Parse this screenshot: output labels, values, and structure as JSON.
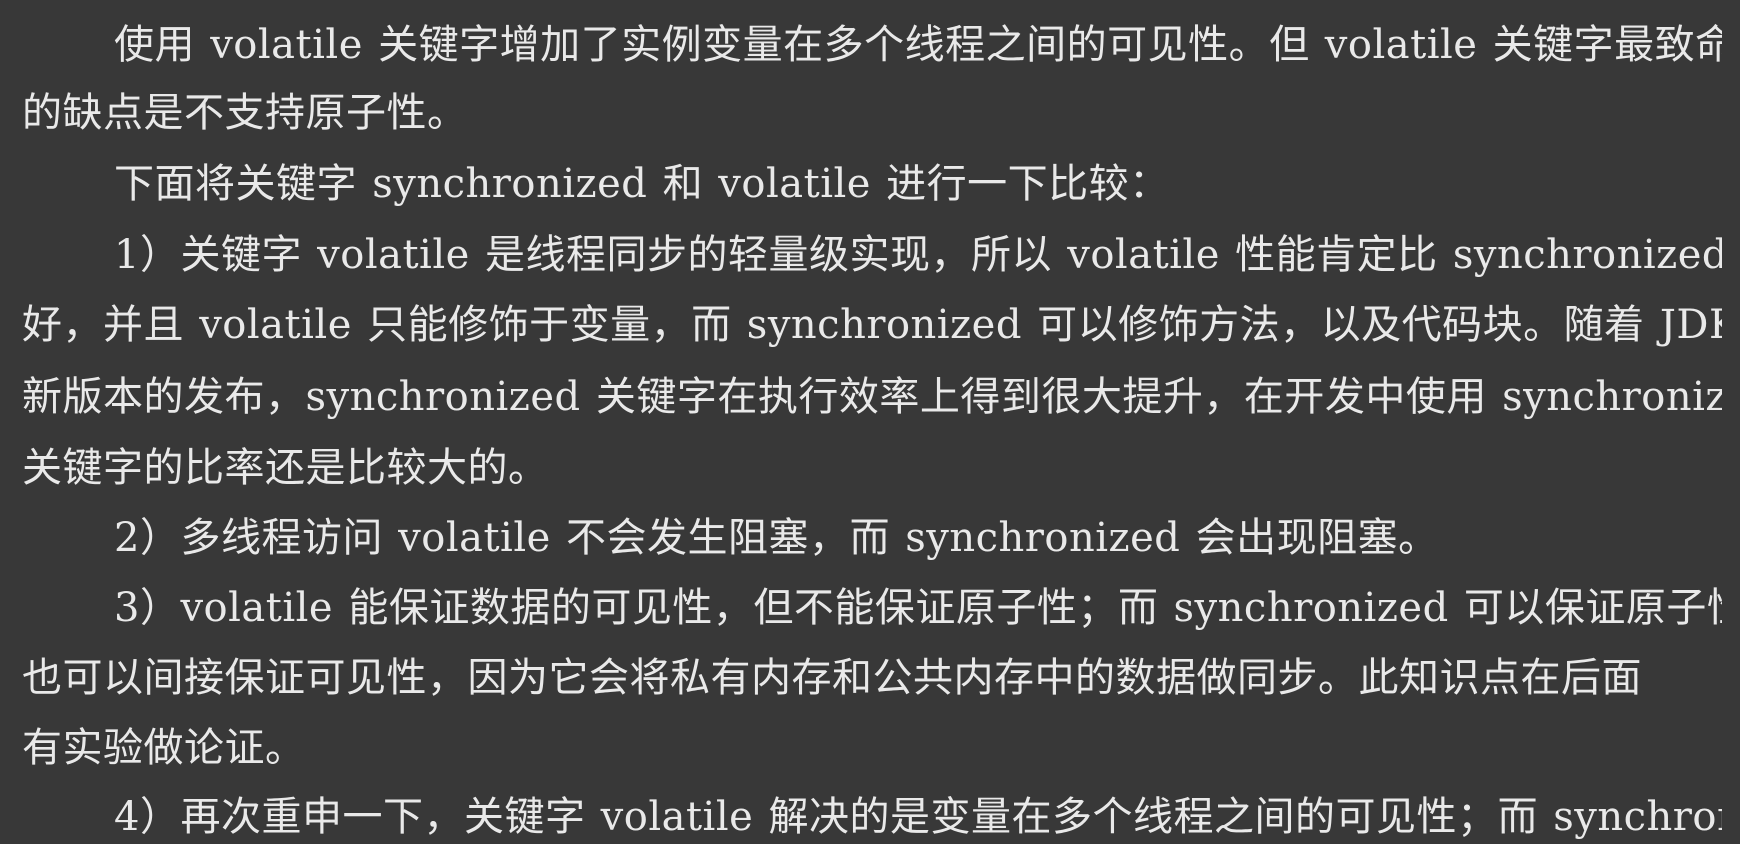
{
  "document": {
    "lines": [
      "使用 volatile 关键字增加了实例变量在多个线程之间的可见性。但 volatile 关键字最致命",
      "的缺点是不支持原子性。",
      "下面将关键字 synchronized 和 volatile 进行一下比较：",
      "1）关键字 volatile 是线程同步的轻量级实现，所以 volatile 性能肯定比 synchronized 要",
      "好，并且 volatile 只能修饰于变量，而 synchronized 可以修饰方法，以及代码块。随着 JDK",
      "新版本的发布，synchronized 关键字在执行效率上得到很大提升，在开发中使用 synchronized",
      "关键字的比率还是比较大的。",
      "2）多线程访问 volatile 不会发生阻塞，而 synchronized 会出现阻塞。",
      "3）volatile 能保证数据的可见性，但不能保证原子性；而 synchronized 可以保证原子性，",
      "也可以间接保证可见性，因为它会将私有内存和公共内存中的数据做同步。此知识点在后面",
      "有实验做论证。",
      "4）再次重申一下，关键字 volatile 解决的是变量在多个线程之间的可见性；而 synchronized"
    ]
  }
}
